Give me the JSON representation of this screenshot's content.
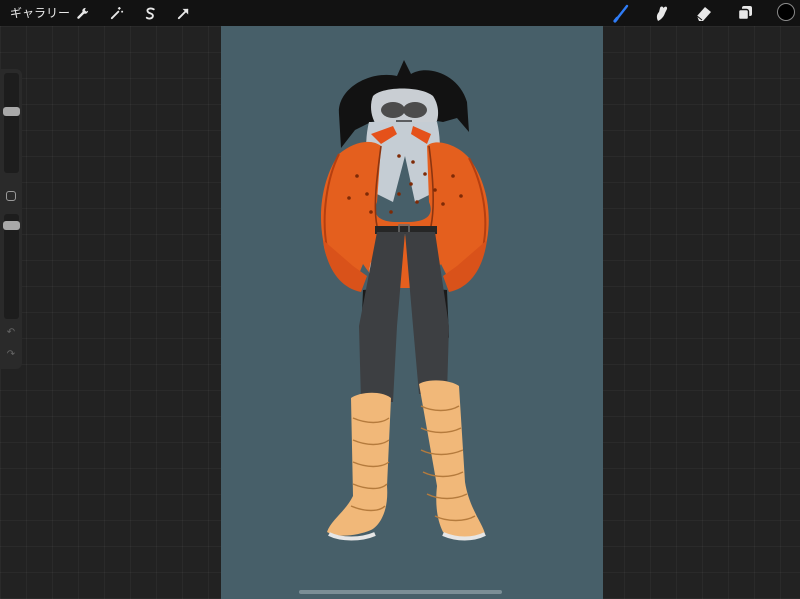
{
  "topbar": {
    "gallery_label": "ギャラリー",
    "left_tools": [
      "wrench-icon",
      "magic-wand-icon",
      "selection-icon",
      "transform-arrow-icon"
    ],
    "right_tools": [
      "brush-icon",
      "smudge-icon",
      "eraser-icon",
      "layers-icon"
    ],
    "active_tool": "brush-icon",
    "active_color": "#000000",
    "accent_color": "#2f7cf6"
  },
  "sidebar": {
    "brush_size_level": 0.72,
    "opacity_level": 0.95,
    "icons": [
      "modify-square-icon",
      "undo-icon",
      "redo-icon"
    ]
  },
  "canvas": {
    "background_color": "#475f69",
    "subject": "character-illustration"
  }
}
